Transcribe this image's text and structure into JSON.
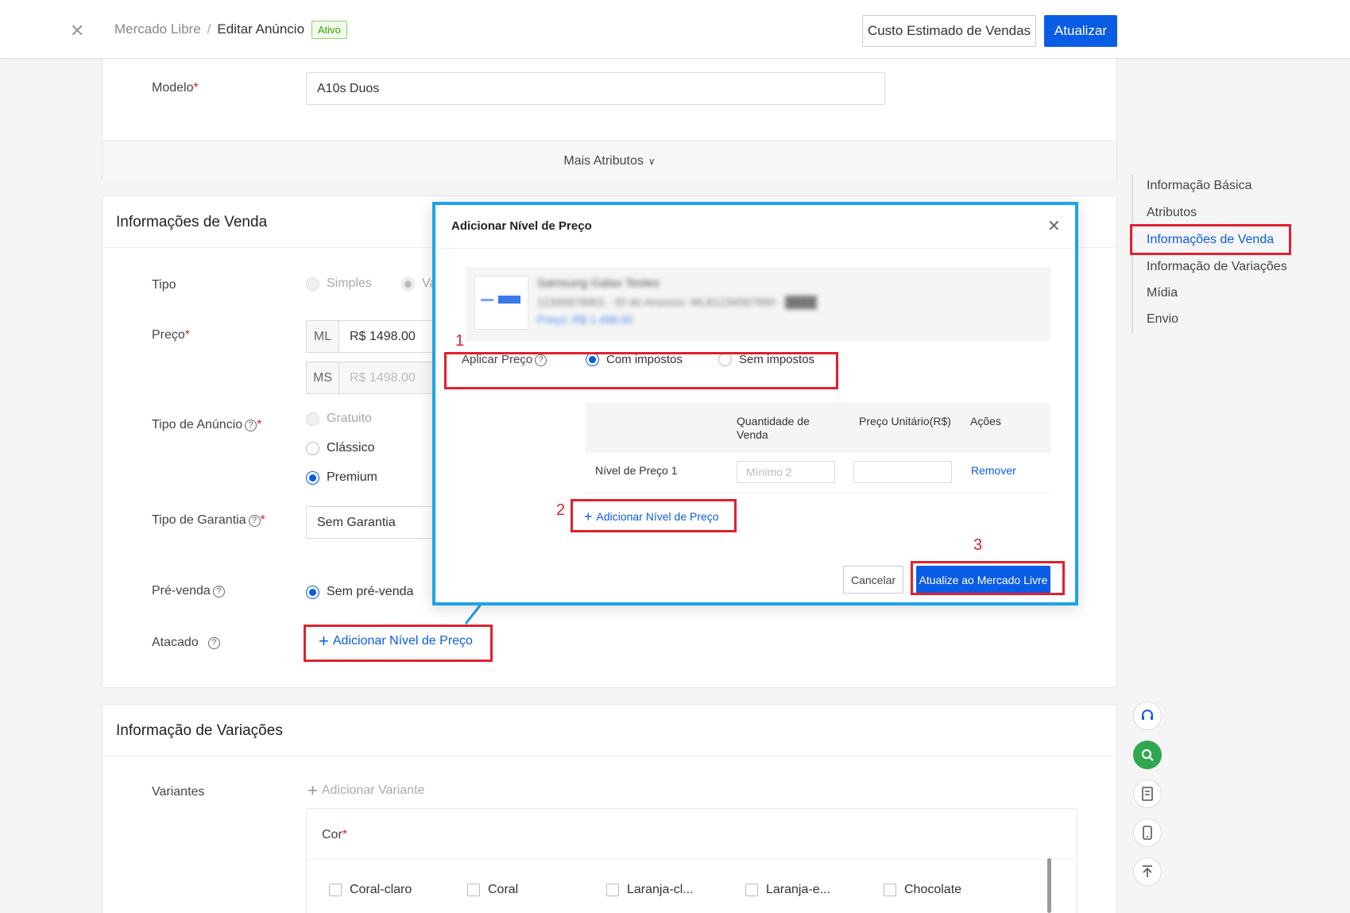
{
  "header": {
    "breadcrumb_root": "Mercado Libre",
    "breadcrumb_sep": "/",
    "breadcrumb_current": "Editar Anúncio",
    "status_badge": "Ativo",
    "estimate_button": "Custo Estimado de Vendas",
    "update_button": "Atualizar"
  },
  "attributes": {
    "model_label": "Modelo",
    "model_value": "A10s Duos",
    "more_attributes": "Mais Atributos"
  },
  "sales": {
    "title": "Informações de Venda",
    "type_label": "Tipo",
    "type_simple": "Simples",
    "type_var": "Va",
    "price_label": "Preço",
    "price_ml_prefix": "ML",
    "price_ml_value": "R$ 1498.00",
    "price_ms_prefix": "MS",
    "price_ms_placeholder": "R$ 1498.00",
    "listing_type_label": "Tipo de Anúncio",
    "listing_free": "Gratuito",
    "listing_classic": "Clássico",
    "listing_premium": "Premium",
    "warranty_label": "Tipo de Garantia",
    "warranty_value": "Sem Garantia",
    "presale_label": "Pré-venda",
    "presale_none": "Sem pré-venda",
    "wholesale_label": "Atacado",
    "add_price_level": "Adicionar Nível de Preço"
  },
  "right_nav": {
    "items": [
      "Informação Básica",
      "Atributos",
      "Informações de Venda",
      "Informação de Variações",
      "Mídia",
      "Envio"
    ],
    "active": "Informações de Venda"
  },
  "tools": {
    "support": "headset-icon",
    "search": "search-icon",
    "notes": "document-icon",
    "mobile": "phone-icon",
    "top": "back-to-top-icon"
  },
  "variations": {
    "title": "Informação de Variações",
    "variants_label": "Variantes",
    "add_variant": "Adicionar Variante",
    "color_label": "Cor",
    "colors": [
      "Coral-claro",
      "Coral",
      "Laranja-cl...",
      "Laranja-e...",
      "Chocolate"
    ]
  },
  "modal": {
    "title": "Adicionar Nível de Preço",
    "apply_price_label": "Aplicar Preço",
    "with_tax": "Com impostos",
    "without_tax": "Sem impostos",
    "col_quantity": "Quantidade de Venda",
    "col_unit_price": "Preço Unitário(R$)",
    "col_actions": "Ações",
    "row_label": "Nível de Preço 1",
    "min_placeholder": "Mínimo 2",
    "remove": "Remover",
    "add_level": "Adicionar Nível de Preço",
    "cancel": "Cancelar",
    "submit": "Atualize ao Mercado Livre"
  },
  "annotations": {
    "step1": "1",
    "step2": "2",
    "step3": "3"
  },
  "colors": {
    "primary": "#0b5ce5",
    "annotation_red": "#e02030",
    "modal_border": "#1ea3e8",
    "active_green": "#37a500"
  }
}
